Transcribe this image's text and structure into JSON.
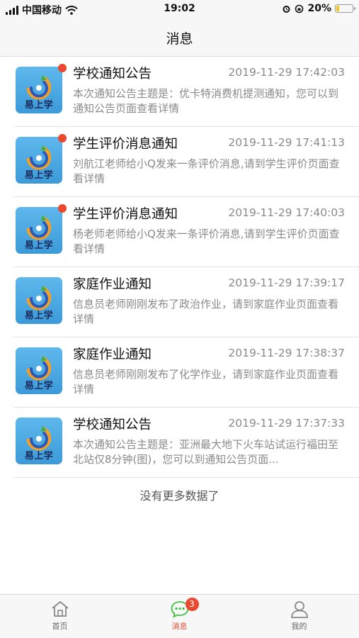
{
  "status_bar": {
    "carrier": "中国移动",
    "time": "19:02",
    "battery": "20%",
    "battery_level": 0.2,
    "icons": [
      "signal-icon",
      "wifi-icon",
      "alarm-icon",
      "orientation-lock-icon",
      "battery-icon"
    ]
  },
  "nav": {
    "title": "消息"
  },
  "avatar_text": "易上学",
  "messages": [
    {
      "title": "学校通知公告",
      "time": "2019-11-29 17:42:03",
      "body": "本次通知公告主题是：优卡特消费机提测通知，您可以到通知公告页面查看详情",
      "unread": true
    },
    {
      "title": "学生评价消息通知",
      "time": "2019-11-29 17:41:13",
      "body": "刘航江老师给小Q发来一条评价消息,请到学生评价页面查看详情",
      "unread": true
    },
    {
      "title": "学生评价消息通知",
      "time": "2019-11-29 17:40:03",
      "body": "杨老师老师给小Q发来一条评价消息,请到学生评价页面查看详情",
      "unread": true
    },
    {
      "title": "家庭作业通知",
      "time": "2019-11-29 17:39:17",
      "body": "信息员老师刚刚发布了政治作业，请到家庭作业页面查看详情",
      "unread": false
    },
    {
      "title": "家庭作业通知",
      "time": "2019-11-29 17:38:37",
      "body": "信息员老师刚刚发布了化学作业，请到家庭作业页面查看详情",
      "unread": false
    },
    {
      "title": "学校通知公告",
      "time": "2019-11-29 17:37:33",
      "body": "本次通知公告主题是：亚洲最大地下火车站试运行福田至北站仅8分钟(图)，您可以到通知公告页面...",
      "unread": false
    }
  ],
  "footer_text": "没有更多数据了",
  "tabs": [
    {
      "label": "首页",
      "icon": "home-icon",
      "active": false
    },
    {
      "label": "消息",
      "icon": "chat-icon",
      "active": true,
      "badge": "3"
    },
    {
      "label": "我的",
      "icon": "user-icon",
      "active": false
    }
  ],
  "colors": {
    "accent": "#e8492f",
    "active_tab": "#3cbf3c",
    "avatar_bg": "#4aa8e2",
    "muted_text": "#8a8a8a"
  }
}
